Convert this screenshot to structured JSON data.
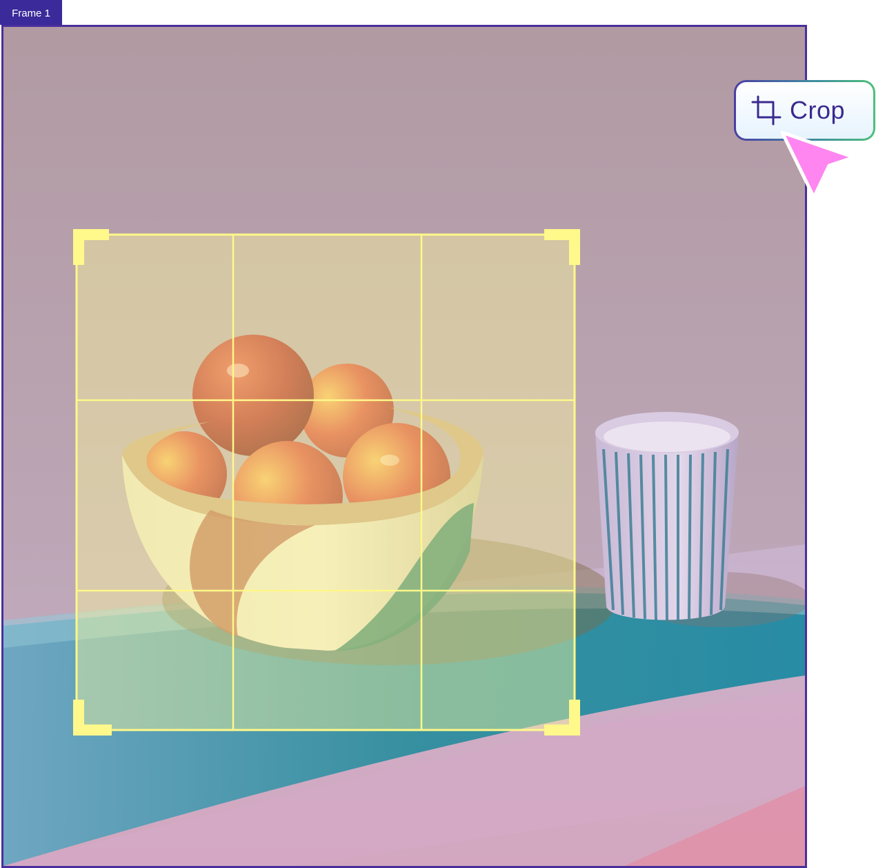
{
  "frame": {
    "label": "Frame 1"
  },
  "toolbar": {
    "crop_label": "Crop",
    "crop_icon": "crop-icon"
  },
  "cursor": {
    "icon": "pointer-cursor-icon",
    "color": "#ff85f0"
  },
  "colors": {
    "frame_border": "#4a2f9c",
    "crop_overlay": "#fffd9a",
    "crop_handles": "#fff88a",
    "crop_label": "#3b2a8f"
  }
}
